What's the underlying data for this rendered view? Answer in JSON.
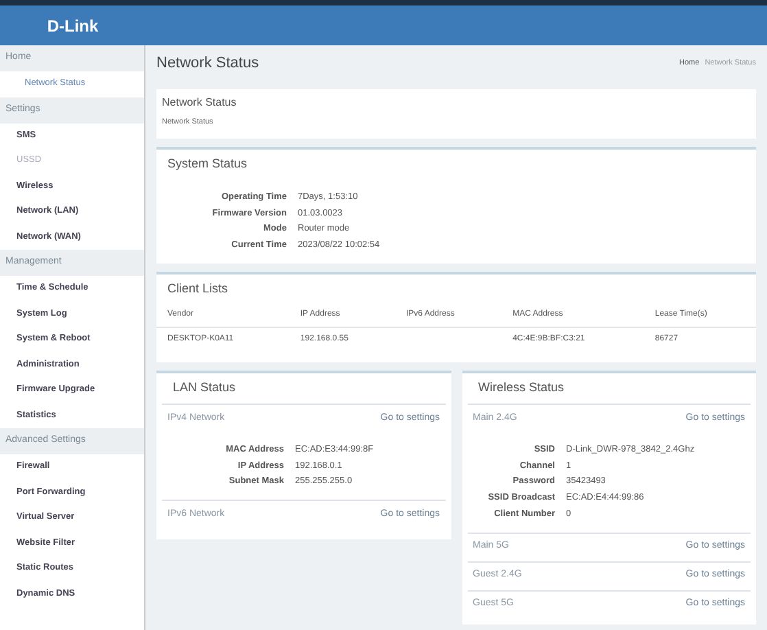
{
  "logo": "D-Link",
  "sidebar": {
    "groups": [
      {
        "title": "Home",
        "items": [
          {
            "label": "Network Status",
            "selected": true,
            "disabled": false
          }
        ]
      },
      {
        "title": "Settings",
        "items": [
          {
            "label": "SMS",
            "selected": false,
            "disabled": false
          },
          {
            "label": "USSD",
            "selected": false,
            "disabled": true
          },
          {
            "label": "Wireless",
            "selected": false,
            "disabled": false
          },
          {
            "label": "Network (LAN)",
            "selected": false,
            "disabled": false
          },
          {
            "label": "Network (WAN)",
            "selected": false,
            "disabled": false
          }
        ]
      },
      {
        "title": "Management",
        "items": [
          {
            "label": "Time & Schedule",
            "selected": false,
            "disabled": false
          },
          {
            "label": "System Log",
            "selected": false,
            "disabled": false
          },
          {
            "label": "System & Reboot",
            "selected": false,
            "disabled": false
          },
          {
            "label": "Administration",
            "selected": false,
            "disabled": false
          },
          {
            "label": "Firmware Upgrade",
            "selected": false,
            "disabled": false
          },
          {
            "label": "Statistics",
            "selected": false,
            "disabled": false
          }
        ]
      },
      {
        "title": "Advanced Settings",
        "items": [
          {
            "label": "Firewall",
            "selected": false,
            "disabled": false
          },
          {
            "label": "Port Forwarding",
            "selected": false,
            "disabled": false
          },
          {
            "label": "Virtual Server",
            "selected": false,
            "disabled": false
          },
          {
            "label": "Website Filter",
            "selected": false,
            "disabled": false
          },
          {
            "label": "Static Routes",
            "selected": false,
            "disabled": false
          },
          {
            "label": "Dynamic DNS",
            "selected": false,
            "disabled": false
          }
        ]
      }
    ]
  },
  "page_title": "Network Status",
  "breadcrumb": [
    "Home",
    "Network Status"
  ],
  "intro": {
    "title": "Network Status",
    "text": "Network Status"
  },
  "system_status": {
    "title": "System Status",
    "fields": [
      {
        "label": "Operating Time",
        "value": "7Days, 1:53:10"
      },
      {
        "label": "Firmware Version",
        "value": "01.03.0023"
      },
      {
        "label": "Mode",
        "value": "Router mode"
      },
      {
        "label": "Current Time",
        "value": "2023/08/22 10:02:54"
      }
    ]
  },
  "client_lists": {
    "title": "Client Lists",
    "columns": [
      "Vendor",
      "IP Address",
      "IPv6 Address",
      "MAC Address",
      "Lease Time(s)"
    ],
    "rows": [
      [
        "DESKTOP-K0A11",
        "192.168.0.55",
        "",
        "4C:4E:9B:BF:C3:21",
        "86727"
      ]
    ]
  },
  "lan_status": {
    "title": "LAN Status",
    "sections": [
      {
        "title": "IPv4 Network",
        "link": "Go to settings",
        "fields": [
          {
            "label": "MAC Address",
            "value": "EC:AD:E3:44:99:8F"
          },
          {
            "label": "IP Address",
            "value": "192.168.0.1"
          },
          {
            "label": "Subnet Mask",
            "value": "255.255.255.0"
          }
        ]
      },
      {
        "title": "IPv6 Network",
        "link": "Go to settings"
      }
    ]
  },
  "wireless_status": {
    "title": "Wireless Status",
    "sections": [
      {
        "title": "Main 2.4G",
        "link": "Go to settings",
        "fields": [
          {
            "label": "SSID",
            "value": "D-Link_DWR-978_3842_2.4Ghz"
          },
          {
            "label": "Channel",
            "value": "1"
          },
          {
            "label": "Password",
            "value": "35423493"
          },
          {
            "label": "SSID Broadcast",
            "value": "EC:AD:E4:44:99:86"
          },
          {
            "label": "Client Number",
            "value": "0"
          }
        ]
      },
      {
        "title": "Main 5G",
        "link": "Go to settings"
      },
      {
        "title": "Guest 2.4G",
        "link": "Go to settings"
      },
      {
        "title": "Guest 5G",
        "link": "Go to settings"
      }
    ]
  }
}
